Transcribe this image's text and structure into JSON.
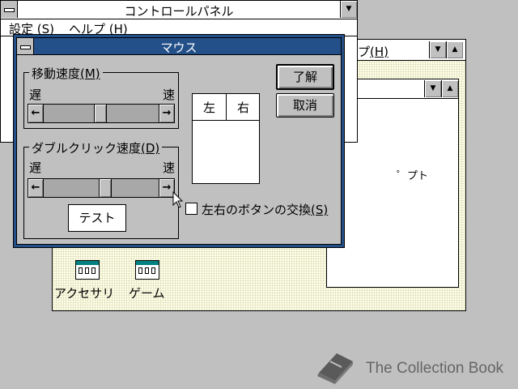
{
  "control_panel": {
    "title": "コントロールパネル",
    "menu": [
      {
        "label": "設定",
        "mnemonic": "(S)"
      },
      {
        "label": "ヘルプ",
        "mnemonic": "(H)"
      }
    ],
    "maximize_glyph": "▼"
  },
  "bg_window": {
    "menu_fragment": "ップ",
    "menu_fragment_mnemonic": "(H)",
    "minimize_glyph": "▼",
    "maximize_glyph": "▲",
    "inner_fragment": "゜プト",
    "icons": [
      {
        "label": "アクセサリ",
        "icon": "program-group-icon"
      },
      {
        "label": "ゲーム",
        "icon": "program-group-icon"
      }
    ]
  },
  "mouse_dialog": {
    "title": "マウス",
    "tracking": {
      "label": "移動速度",
      "mnemonic": "(M)",
      "slow": "遅",
      "fast": "速",
      "value": 0.5
    },
    "double_click": {
      "label": "ダブルクリック速度",
      "mnemonic": "(D)",
      "slow": "遅",
      "fast": "速",
      "value": 0.55,
      "test_label": "テスト"
    },
    "buttons_preview": {
      "left": "左",
      "right": "右"
    },
    "swap": {
      "label": "左右のボタンの交換",
      "mnemonic": "(S)",
      "checked": false
    },
    "ok_label": "了解",
    "cancel_label": "取消",
    "left_arrow": "←",
    "right_arrow": "→"
  },
  "watermark": {
    "text": "The Collection Book",
    "icon": "book-icon"
  },
  "colors": {
    "desktop": "#c0c0c0",
    "active_title": "#24508a",
    "inactive_title": "#ffffff",
    "workspace": "#ffffe8"
  }
}
